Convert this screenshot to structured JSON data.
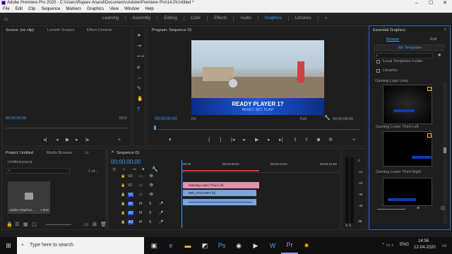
{
  "titlebar": {
    "title": "Adobe Premiere Pro 2020 - C:\\Users\\Rajeev Anand\\Documents\\Adobe\\Premiere Pro\\14.0\\Untitled *"
  },
  "menu": [
    "File",
    "Edit",
    "Clip",
    "Sequence",
    "Markers",
    "Graphics",
    "View",
    "Window",
    "Help"
  ],
  "workspaces": [
    "Learning",
    "Assembly",
    "Editing",
    "Color",
    "Effects",
    "Audio",
    "Graphics",
    "Libraries",
    "»"
  ],
  "active_workspace": "Graphics",
  "source_panel": {
    "tab_source": "Source: (no clip)",
    "tab_scopes": "Lumetri Scopes",
    "tab_effect_controls": "Effect Controls",
    "tc_left": "00;00;00;00",
    "tc_right": "00;0"
  },
  "program": {
    "tab": "Program: Sequence 01",
    "timecode": "00;00;00;00",
    "fit": "Fit",
    "quality": "Full",
    "duration": "00;00;08;00"
  },
  "video_overlay": {
    "headline": "READY PLAYER 1?",
    "sub": "READY. SET. PLAY!"
  },
  "project": {
    "tab": "Project: Untitled",
    "tab_media": "Media Browser",
    "tab_lib": "Li",
    "file": "Untitled.prproj",
    "search_placeholder": "",
    "items_count": "1 of...",
    "bin_label": "Adobe Graphics ...",
    "bin_count": "1 Item"
  },
  "sequence": {
    "tab": "Sequence 01",
    "timecode": "00;00;00;00",
    "ruler": [
      "00;00",
      "00;00;05;00",
      "00;00;10;00",
      "00;00;15;00"
    ]
  },
  "tracks": [
    {
      "name": "V3",
      "type": "video"
    },
    {
      "name": "V2",
      "type": "video"
    },
    {
      "name": "V1",
      "type": "video"
    },
    {
      "name": "A1",
      "type": "audio"
    },
    {
      "name": "A2",
      "type": "audio"
    },
    {
      "name": "A3",
      "type": "audio"
    }
  ],
  "clips": [
    {
      "label": "Gaming Lower Third Left",
      "track": "V2",
      "color": "#e58fb2"
    },
    {
      "label": "IMG_0733.MP4 [V]",
      "track": "V1",
      "color": "#7aa4de"
    },
    {
      "label": "",
      "track": "A1",
      "color": "#7aa4de"
    }
  ],
  "meter_scale": [
    "0",
    "-12",
    "-24",
    "-36",
    "-48",
    "dB"
  ],
  "essential_graphics": {
    "title": "Essential Graphics",
    "tab_browse": "Browse",
    "tab_edit": "Edit",
    "my_templates": "My Templates",
    "local_templates_folder": "Local Templates Folder",
    "libraries": "Libraries",
    "templates": [
      {
        "name": "Gaming Logo Loop"
      },
      {
        "name": "Gaming Lower Third Left"
      },
      {
        "name": "Gaming Lower Third Right"
      }
    ]
  },
  "taskbar": {
    "search_placeholder": "Type here to search",
    "time": "14:56",
    "date": "12-04-2020",
    "lang": "ENG"
  },
  "icons": {
    "search": "search-icon",
    "windows": "windows-logo-icon"
  }
}
